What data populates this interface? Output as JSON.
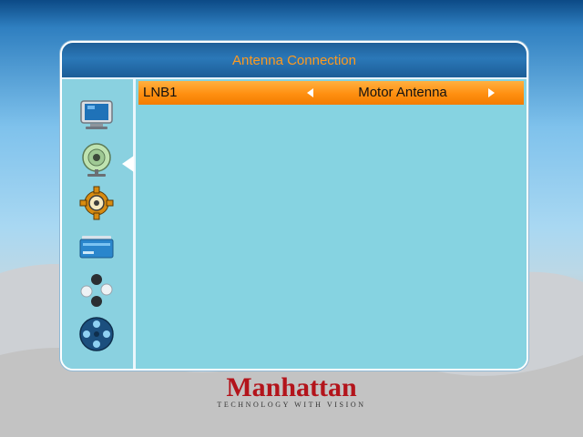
{
  "window": {
    "title": "Antenna Connection"
  },
  "sidebar": {
    "items": [
      {
        "icon": "tv-icon"
      },
      {
        "icon": "satellite-dish-icon"
      },
      {
        "icon": "settings-gear-icon"
      },
      {
        "icon": "card-icon"
      },
      {
        "icon": "game-icon"
      },
      {
        "icon": "media-reel-icon"
      }
    ],
    "selected_index": 1
  },
  "settings": {
    "rows": [
      {
        "label": "LNB1",
        "value": "Motor Antenna"
      }
    ]
  },
  "brand": {
    "name": "Manhattan",
    "tagline": "TECHNOLOGY WITH VISION"
  },
  "colors": {
    "title_text": "#ff9a1e",
    "highlight_row": "#ff8f10",
    "panel_bg": "#86d3e1",
    "brand_red": "#b3141b"
  }
}
